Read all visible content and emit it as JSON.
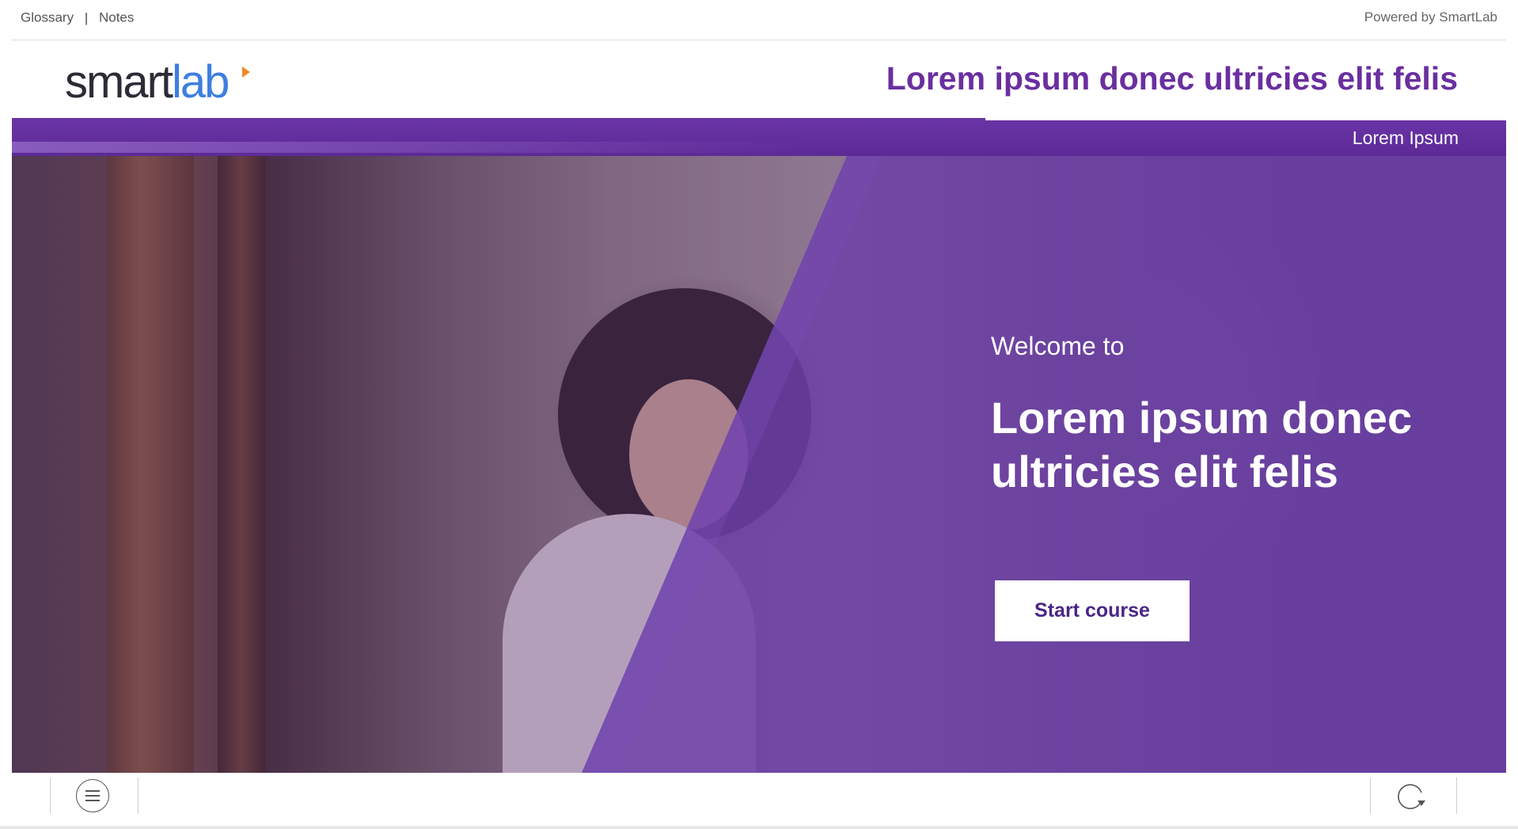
{
  "top_bar": {
    "glossary_label": "Glossary",
    "separator": "|",
    "notes_label": "Notes",
    "powered_by": "Powered by SmartLab"
  },
  "header": {
    "logo": {
      "part1": "smart",
      "part2": "lab",
      "icon": "play-triangle-icon"
    },
    "course_title": "Lorem ipsum donec ultricies elit felis"
  },
  "hero": {
    "band_label": "Lorem Ipsum",
    "welcome": "Welcome to",
    "title": "Lorem ipsum donec ultricies elit felis",
    "start_button": "Start course"
  },
  "bottom_nav": {
    "menu_icon": "menu-icon",
    "reload_icon": "reload-icon"
  },
  "colors": {
    "brand_purple": "#6a2fa0",
    "overlay_purple": "#6b3ea8",
    "logo_blue": "#3d7fe0",
    "logo_orange": "#f08a24"
  }
}
